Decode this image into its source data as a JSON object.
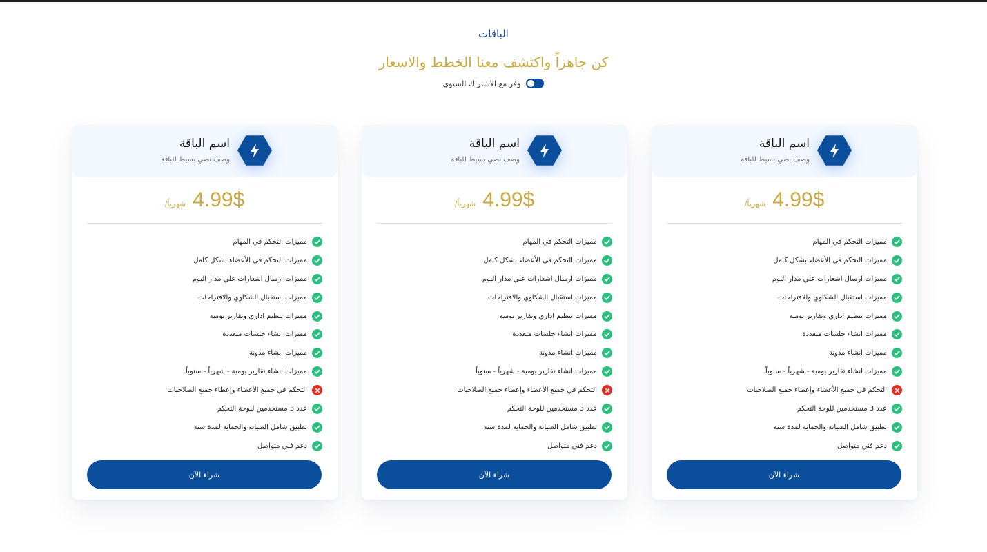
{
  "header": {
    "section_label": "الباقات",
    "headline": "كن جاهزاً واكتشف معنا الخطط والاسعار",
    "toggle_label": "وفر مع الاشتراك السنوي",
    "toggle_on": true
  },
  "colors": {
    "primary": "#0b4f9c",
    "gold": "#c8a941",
    "check": "#2bbf7e",
    "cross": "#d93025",
    "card_head_bg": "#f3f8fe"
  },
  "plans": [
    {
      "icon": "lightning-icon",
      "title": "اسم الباقة",
      "description": "وصف نصي بسيط للباقة",
      "price": "4.99$",
      "period": "شهرياً/",
      "buy_label": "شراء الآن",
      "features": [
        {
          "text": "مميزات التحكم في المهام",
          "included": true
        },
        {
          "text": "مميزات التحكم في الأعضاء بشكل كامل",
          "included": true
        },
        {
          "text": "مميزات ارسال اشعارات علي مدار اليوم",
          "included": true
        },
        {
          "text": "مميزات استقبال الشكاوي والاقتراحات",
          "included": true
        },
        {
          "text": "مميزات تنظيم اداري وتقارير يوميه",
          "included": true
        },
        {
          "text": "مميزات انشاء جلسات متعددة",
          "included": true
        },
        {
          "text": "مميزات انشاء مدونة",
          "included": true
        },
        {
          "text": "مميزات انشاء تقارير يومية - شهرياً - سنوياً",
          "included": true
        },
        {
          "text": "التحكم في جميع الأعضاء وإعطاء جميع الصلاحيات",
          "included": false
        },
        {
          "text": "عدد 3 مستخدمين للوحة التحكم",
          "included": true
        },
        {
          "text": "تطبيق شامل الصيانة والحماية لمدة سنة",
          "included": true
        },
        {
          "text": "دعم فني متواصل",
          "included": true
        }
      ]
    },
    {
      "icon": "lightning-icon",
      "title": "اسم الباقة",
      "description": "وصف نصي بسيط للباقة",
      "price": "4.99$",
      "period": "شهرياً/",
      "buy_label": "شراء الآن",
      "features": [
        {
          "text": "مميزات التحكم في المهام",
          "included": true
        },
        {
          "text": "مميزات التحكم في الأعضاء بشكل كامل",
          "included": true
        },
        {
          "text": "مميزات ارسال اشعارات علي مدار اليوم",
          "included": true
        },
        {
          "text": "مميزات استقبال الشكاوي والاقتراحات",
          "included": true
        },
        {
          "text": "مميزات تنظيم اداري وتقارير يوميه",
          "included": true
        },
        {
          "text": "مميزات انشاء جلسات متعددة",
          "included": true
        },
        {
          "text": "مميزات انشاء مدونة",
          "included": true
        },
        {
          "text": "مميزات انشاء تقارير يومية - شهرياً - سنوياً",
          "included": true
        },
        {
          "text": "التحكم في جميع الأعضاء وإعطاء جميع الصلاحيات",
          "included": false
        },
        {
          "text": "عدد 3 مستخدمين للوحة التحكم",
          "included": true
        },
        {
          "text": "تطبيق شامل الصيانة والحماية لمدة سنة",
          "included": true
        },
        {
          "text": "دعم فني متواصل",
          "included": true
        }
      ]
    },
    {
      "icon": "lightning-icon",
      "title": "اسم الباقة",
      "description": "وصف نصي بسيط للباقة",
      "price": "4.99$",
      "period": "شهرياً/",
      "buy_label": "شراء الآن",
      "features": [
        {
          "text": "مميزات التحكم في المهام",
          "included": true
        },
        {
          "text": "مميزات التحكم في الأعضاء بشكل كامل",
          "included": true
        },
        {
          "text": "مميزات ارسال اشعارات علي مدار اليوم",
          "included": true
        },
        {
          "text": "مميزات استقبال الشكاوي والاقتراحات",
          "included": true
        },
        {
          "text": "مميزات تنظيم اداري وتقارير يوميه",
          "included": true
        },
        {
          "text": "مميزات انشاء جلسات متعددة",
          "included": true
        },
        {
          "text": "مميزات انشاء مدونة",
          "included": true
        },
        {
          "text": "مميزات انشاء تقارير يومية - شهرياً - سنوياً",
          "included": true
        },
        {
          "text": "التحكم في جميع الأعضاء وإعطاء جميع الصلاحيات",
          "included": false
        },
        {
          "text": "عدد 3 مستخدمين للوحة التحكم",
          "included": true
        },
        {
          "text": "تطبيق شامل الصيانة والحماية لمدة سنة",
          "included": true
        },
        {
          "text": "دعم فني متواصل",
          "included": true
        }
      ]
    }
  ]
}
